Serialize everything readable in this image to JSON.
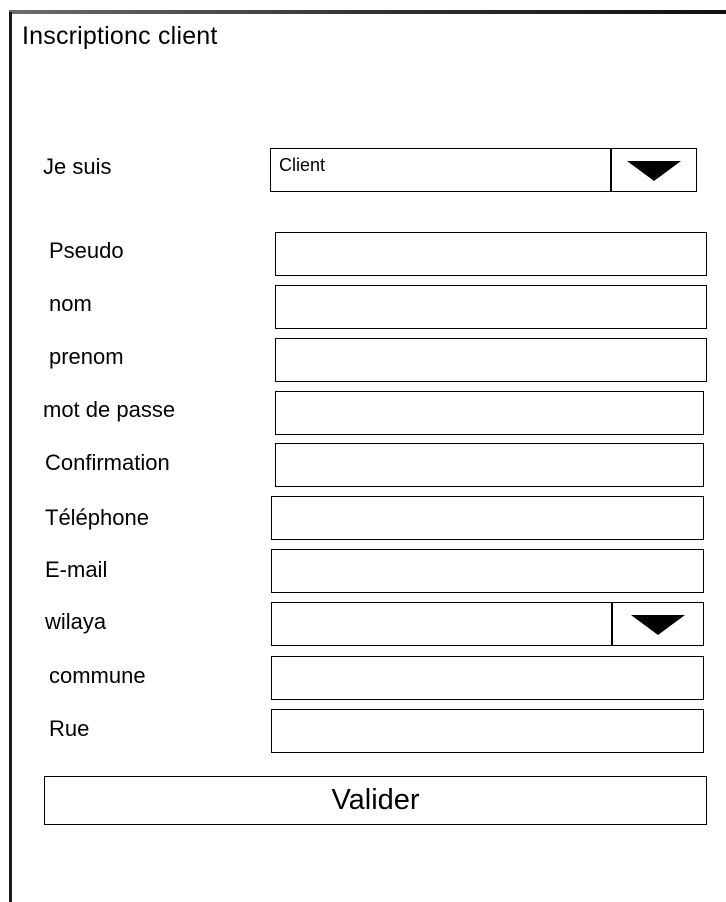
{
  "form": {
    "title": "Inscriptionc client",
    "type": {
      "label": "Je suis",
      "value": "Client"
    },
    "fields": {
      "pseudo": "Pseudo",
      "nom": "nom",
      "prenom": "prenom",
      "mot_de_passe": "mot de passe",
      "confirmation": "Confirmation",
      "telephone": "Téléphone",
      "email": "E-mail",
      "wilaya": "wilaya",
      "commune": "commune",
      "rue": "Rue"
    },
    "submit_label": "Valider"
  },
  "icons": {
    "dropdown": "caret-down-icon"
  },
  "colors": {
    "background": "#ffffff",
    "border": "#000000",
    "text": "#000000"
  }
}
